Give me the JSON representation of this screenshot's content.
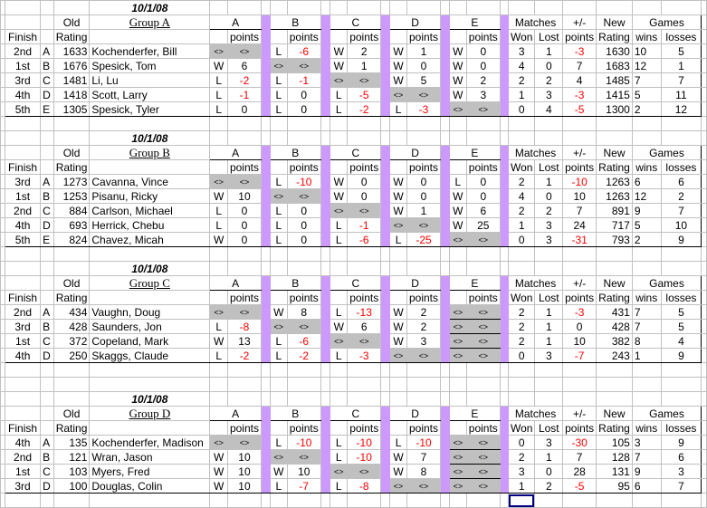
{
  "headers": {
    "old": "Old",
    "rating": "Rating",
    "finish": "Finish",
    "points": "points",
    "matches": "Matches",
    "won": "Won",
    "lost": "Lost",
    "plusminus": "+/-",
    "new": "New",
    "games": "Games",
    "wins": "wins",
    "losses": "losses",
    "opponents": [
      "A",
      "B",
      "C",
      "D",
      "E"
    ]
  },
  "colors": {
    "divider": "#cc99ff",
    "self_match": "#c0c0c0",
    "negative": "#ff0000"
  },
  "self_marker": "<>",
  "groups": [
    {
      "date": "10/1/08",
      "title": "Group A",
      "players": [
        {
          "finish": "2nd",
          "seed": "A",
          "old": "1633",
          "name": "Kochenderfer, Bill",
          "results": [
            [
              "<>",
              "<>"
            ],
            [
              "L",
              "-6"
            ],
            [
              "W",
              "2"
            ],
            [
              "W",
              "1"
            ],
            [
              "W",
              "0"
            ]
          ],
          "won": "3",
          "lost": "1",
          "pm": "-3",
          "new": "1630",
          "gw": "10",
          "gl": "5"
        },
        {
          "finish": "1st",
          "seed": "B",
          "old": "1676",
          "name": "Spesick, Tom",
          "results": [
            [
              "W",
              "6"
            ],
            [
              "<>",
              "<>"
            ],
            [
              "W",
              "1"
            ],
            [
              "W",
              "0"
            ],
            [
              "W",
              "0"
            ]
          ],
          "won": "4",
          "lost": "0",
          "pm": "7",
          "new": "1683",
          "gw": "12",
          "gl": "1"
        },
        {
          "finish": "3rd",
          "seed": "C",
          "old": "1481",
          "name": "Li, Lu",
          "results": [
            [
              "L",
              "-2"
            ],
            [
              "L",
              "-1"
            ],
            [
              "<>",
              "<>"
            ],
            [
              "W",
              "5"
            ],
            [
              "W",
              "2"
            ]
          ],
          "won": "2",
          "lost": "2",
          "pm": "4",
          "new": "1485",
          "gw": "7",
          "gl": "7"
        },
        {
          "finish": "4th",
          "seed": "D",
          "old": "1418",
          "name": "Scott, Larry",
          "results": [
            [
              "L",
              "-1"
            ],
            [
              "L",
              "0"
            ],
            [
              "L",
              "-5"
            ],
            [
              "<>",
              "<>"
            ],
            [
              "W",
              "3"
            ]
          ],
          "won": "1",
          "lost": "3",
          "pm": "-3",
          "new": "1415",
          "gw": "5",
          "gl": "11"
        },
        {
          "finish": "5th",
          "seed": "E",
          "old": "1305",
          "name": "Spesick, Tyler",
          "results": [
            [
              "L",
              "0"
            ],
            [
              "L",
              "0"
            ],
            [
              "L",
              "-2"
            ],
            [
              "L",
              "-3"
            ],
            [
              "<>",
              "<>"
            ]
          ],
          "won": "0",
          "lost": "4",
          "pm": "-5",
          "new": "1300",
          "gw": "2",
          "gl": "12"
        }
      ]
    },
    {
      "date": "10/1/08",
      "title": "Group B",
      "players": [
        {
          "finish": "3rd",
          "seed": "A",
          "old": "1273",
          "name": "Cavanna, Vince",
          "results": [
            [
              "<>",
              "<>"
            ],
            [
              "L",
              "-10"
            ],
            [
              "W",
              "0"
            ],
            [
              "W",
              "0"
            ],
            [
              "L",
              "0"
            ]
          ],
          "won": "2",
          "lost": "1",
          "pm": "-10",
          "new": "1263",
          "gw": "6",
          "gl": "6"
        },
        {
          "finish": "1st",
          "seed": "B",
          "old": "1253",
          "name": "Pisanu, Ricky",
          "results": [
            [
              "W",
              "10"
            ],
            [
              "<>",
              "<>"
            ],
            [
              "W",
              "0"
            ],
            [
              "W",
              "0"
            ],
            [
              "W",
              "0"
            ]
          ],
          "won": "4",
          "lost": "0",
          "pm": "10",
          "new": "1263",
          "gw": "12",
          "gl": "2"
        },
        {
          "finish": "2nd",
          "seed": "C",
          "old": "884",
          "name": "Carlson, Michael",
          "results": [
            [
              "L",
              "0"
            ],
            [
              "L",
              "0"
            ],
            [
              "<>",
              "<>"
            ],
            [
              "W",
              "1"
            ],
            [
              "W",
              "6"
            ]
          ],
          "won": "2",
          "lost": "2",
          "pm": "7",
          "new": "891",
          "gw": "9",
          "gl": "7"
        },
        {
          "finish": "4th",
          "seed": "D",
          "old": "693",
          "name": "Herrick, Chebu",
          "results": [
            [
              "L",
              "0"
            ],
            [
              "L",
              "0"
            ],
            [
              "L",
              "-1"
            ],
            [
              "<>",
              "<>"
            ],
            [
              "W",
              "25"
            ]
          ],
          "won": "1",
          "lost": "3",
          "pm": "24",
          "new": "717",
          "gw": "5",
          "gl": "10"
        },
        {
          "finish": "5th",
          "seed": "E",
          "old": "824",
          "name": "Chavez, Micah",
          "results": [
            [
              "W",
              "0"
            ],
            [
              "L",
              "0"
            ],
            [
              "L",
              "-6"
            ],
            [
              "L",
              "-25"
            ],
            [
              "<>",
              "<>"
            ]
          ],
          "won": "0",
          "lost": "3",
          "pm": "-31",
          "new": "793",
          "gw": "2",
          "gl": "9"
        }
      ]
    },
    {
      "date": "10/1/08",
      "title": "Group C",
      "players": [
        {
          "finish": "2nd",
          "seed": "A",
          "old": "434",
          "name": "Vaughn, Doug",
          "results": [
            [
              "<>",
              "<>"
            ],
            [
              "W",
              "8"
            ],
            [
              "L",
              "-13"
            ],
            [
              "W",
              "2"
            ],
            [
              "<>",
              "<>"
            ]
          ],
          "won": "2",
          "lost": "1",
          "pm": "-3",
          "new": "431",
          "gw": "7",
          "gl": "5"
        },
        {
          "finish": "3rd",
          "seed": "B",
          "old": "428",
          "name": "Saunders, Jon",
          "results": [
            [
              "L",
              "-8"
            ],
            [
              "<>",
              "<>"
            ],
            [
              "W",
              "6"
            ],
            [
              "W",
              "2"
            ],
            [
              "<>",
              "<>"
            ]
          ],
          "won": "2",
          "lost": "1",
          "pm": "0",
          "new": "428",
          "gw": "7",
          "gl": "5"
        },
        {
          "finish": "1st",
          "seed": "C",
          "old": "372",
          "name": "Copeland, Mark",
          "results": [
            [
              "W",
              "13"
            ],
            [
              "L",
              "-6"
            ],
            [
              "<>",
              "<>"
            ],
            [
              "W",
              "3"
            ],
            [
              "<>",
              "<>"
            ]
          ],
          "won": "2",
          "lost": "1",
          "pm": "10",
          "new": "382",
          "gw": "8",
          "gl": "4"
        },
        {
          "finish": "4th",
          "seed": "D",
          "old": "250",
          "name": "Skaggs, Claude",
          "results": [
            [
              "L",
              "-2"
            ],
            [
              "L",
              "-2"
            ],
            [
              "L",
              "-3"
            ],
            [
              "<>",
              "<>"
            ],
            [
              "<>",
              "<>"
            ]
          ],
          "won": "0",
          "lost": "3",
          "pm": "-7",
          "new": "243",
          "gw": "1",
          "gl": "9"
        }
      ]
    },
    {
      "date": "10/1/08",
      "title": "Group D",
      "players": [
        {
          "finish": "4th",
          "seed": "A",
          "old": "135",
          "name": "Kochenderfer, Madison",
          "results": [
            [
              "<>",
              "<>"
            ],
            [
              "L",
              "-10"
            ],
            [
              "L",
              "-10"
            ],
            [
              "L",
              "-10"
            ],
            [
              "<>",
              "<>"
            ]
          ],
          "won": "0",
          "lost": "3",
          "pm": "-30",
          "new": "105",
          "gw": "3",
          "gl": "9"
        },
        {
          "finish": "2nd",
          "seed": "B",
          "old": "121",
          "name": "Wran, Jason",
          "results": [
            [
              "W",
              "10"
            ],
            [
              "<>",
              "<>"
            ],
            [
              "L",
              "-10"
            ],
            [
              "W",
              "7"
            ],
            [
              "<>",
              "<>"
            ]
          ],
          "won": "2",
          "lost": "1",
          "pm": "7",
          "new": "128",
          "gw": "7",
          "gl": "6"
        },
        {
          "finish": "1st",
          "seed": "C",
          "old": "103",
          "name": "Myers, Fred",
          "results": [
            [
              "W",
              "10"
            ],
            [
              "W",
              "10"
            ],
            [
              "<>",
              "<>"
            ],
            [
              "W",
              "8"
            ],
            [
              "<>",
              "<>"
            ]
          ],
          "won": "3",
          "lost": "0",
          "pm": "28",
          "new": "131",
          "gw": "9",
          "gl": "3"
        },
        {
          "finish": "3rd",
          "seed": "D",
          "old": "100",
          "name": "Douglas, Colin",
          "results": [
            [
              "W",
              "10"
            ],
            [
              "L",
              "-7"
            ],
            [
              "L",
              "-8"
            ],
            [
              "<>",
              "<>"
            ],
            [
              "<>",
              "<>"
            ]
          ],
          "won": "1",
          "lost": "2",
          "pm": "-5",
          "new": "95",
          "gw": "6",
          "gl": "7"
        }
      ]
    }
  ]
}
